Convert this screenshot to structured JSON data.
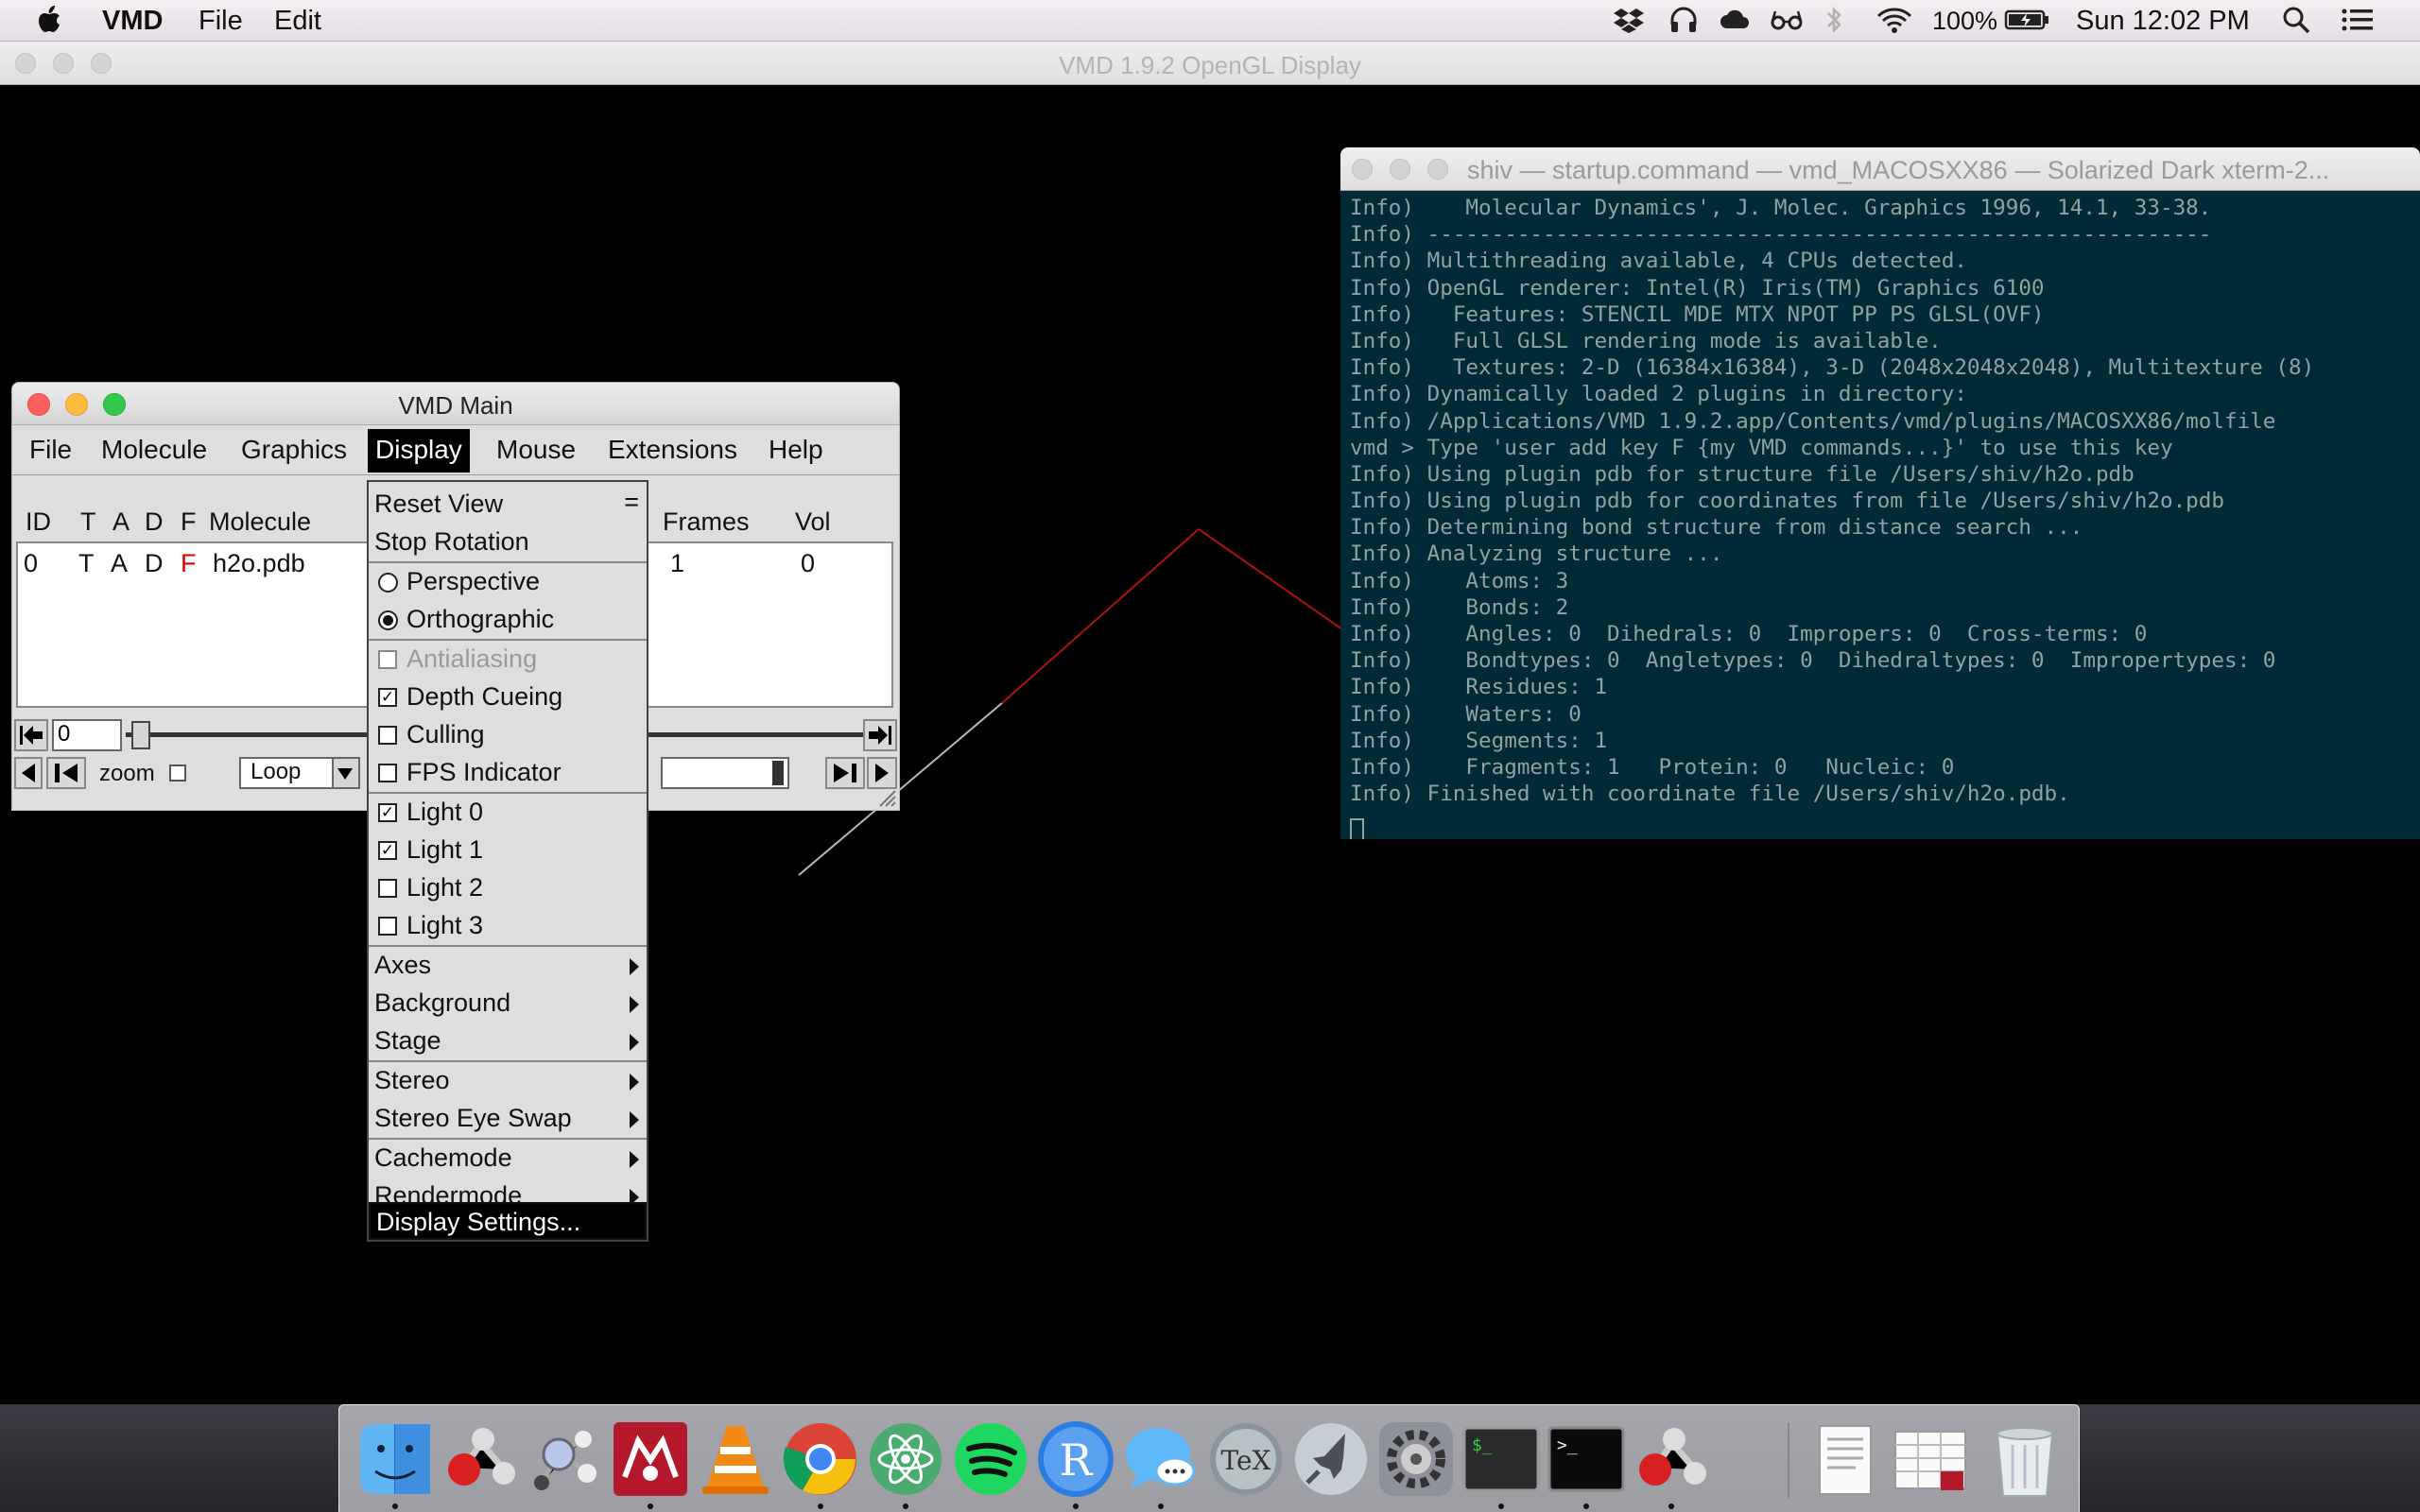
{
  "menubar": {
    "app_name": "VMD",
    "items": [
      "File",
      "Edit"
    ],
    "battery": "100%",
    "clock": "Sun 12:02 PM",
    "status_icons": [
      "dropbox-icon",
      "headphones-icon",
      "cloud-icon",
      "glasses-icon",
      "bluetooth-icon",
      "wifi-icon",
      "battery-icon",
      "spotlight-search-icon",
      "notification-center-icon"
    ]
  },
  "gl_window": {
    "title": "VMD 1.9.2 OpenGL Display"
  },
  "terminal": {
    "title": "shiv — startup.command — vmd_MACOSXX86 — Solarized Dark xterm-2...",
    "lines": [
      "Info)    Molecular Dynamics', J. Molec. Graphics 1996, 14.1, 33-38.",
      "Info) -------------------------------------------------------------",
      "Info) Multithreading available, 4 CPUs detected.",
      "Info) OpenGL renderer: Intel(R) Iris(TM) Graphics 6100",
      "Info)   Features: STENCIL MDE MTX NPOT PP PS GLSL(OVF)",
      "Info)   Full GLSL rendering mode is available.",
      "Info)   Textures: 2-D (16384x16384), 3-D (2048x2048x2048), Multitexture (8)",
      "Info) Dynamically loaded 2 plugins in directory:",
      "Info) /Applications/VMD 1.9.2.app/Contents/vmd/plugins/MACOSXX86/molfile",
      "vmd > Type 'user add key F {my VMD commands...}' to use this key",
      "Info) Using plugin pdb for structure file /Users/shiv/h2o.pdb",
      "Info) Using plugin pdb for coordinates from file /Users/shiv/h2o.pdb",
      "Info) Determining bond structure from distance search ...",
      "Info) Analyzing structure ...",
      "Info)    Atoms: 3",
      "Info)    Bonds: 2",
      "Info)    Angles: 0  Dihedrals: 0  Impropers: 0  Cross-terms: 0",
      "Info)    Bondtypes: 0  Angletypes: 0  Dihedraltypes: 0  Impropertypes: 0",
      "Info)    Residues: 1",
      "Info)    Waters: 0",
      "Info)    Segments: 1",
      "Info)    Fragments: 1   Protein: 0   Nucleic: 0",
      "Info) Finished with coordinate file /Users/shiv/h2o.pdb."
    ]
  },
  "vmd_main": {
    "title": "VMD Main",
    "menus": [
      "File",
      "Molecule",
      "Graphics",
      "Display",
      "Mouse",
      "Extensions",
      "Help"
    ],
    "columns": [
      "ID",
      "T",
      "A",
      "D",
      "F",
      "Molecule",
      "Frames",
      "Vol"
    ],
    "row": {
      "id": "0",
      "t": "T",
      "a": "A",
      "d": "D",
      "f": "F",
      "molecule": "h2o.pdb",
      "frames": "1",
      "vol": "0"
    },
    "frame_value": "0",
    "zoom_label": "zoom",
    "loop_value": "Loop",
    "accent_f_color": "#dd0000"
  },
  "display_menu": {
    "reset_view": "Reset View",
    "reset_view_shortcut": "=",
    "stop_rotation": "Stop Rotation",
    "perspective": "Perspective",
    "orthographic": "Orthographic",
    "antialiasing": "Antialiasing",
    "depth_cueing": "Depth Cueing",
    "culling": "Culling",
    "fps_indicator": "FPS Indicator",
    "light0": "Light 0",
    "light1": "Light 1",
    "light2": "Light 2",
    "light3": "Light 3",
    "axes": "Axes",
    "background": "Background",
    "stage": "Stage",
    "stereo": "Stereo",
    "stereo_eye_swap": "Stereo Eye Swap",
    "cachemode": "Cachemode",
    "rendermode": "Rendermode",
    "display_settings": "Display Settings..."
  },
  "dock": {
    "apps": [
      "finder-icon",
      "vmd-icon",
      "molecule-viewer-icon",
      "mendeley-icon",
      "vlc-icon",
      "chrome-icon",
      "atom-icon",
      "spotify-icon",
      "r-icon",
      "messages-icon",
      "tex-icon",
      "launchpad-icon",
      "system-preferences-icon",
      "terminal-icon",
      "terminal-dark-icon",
      "vmd-app-icon",
      "document-icon",
      "spreadsheet-icon",
      "trash-icon"
    ]
  }
}
